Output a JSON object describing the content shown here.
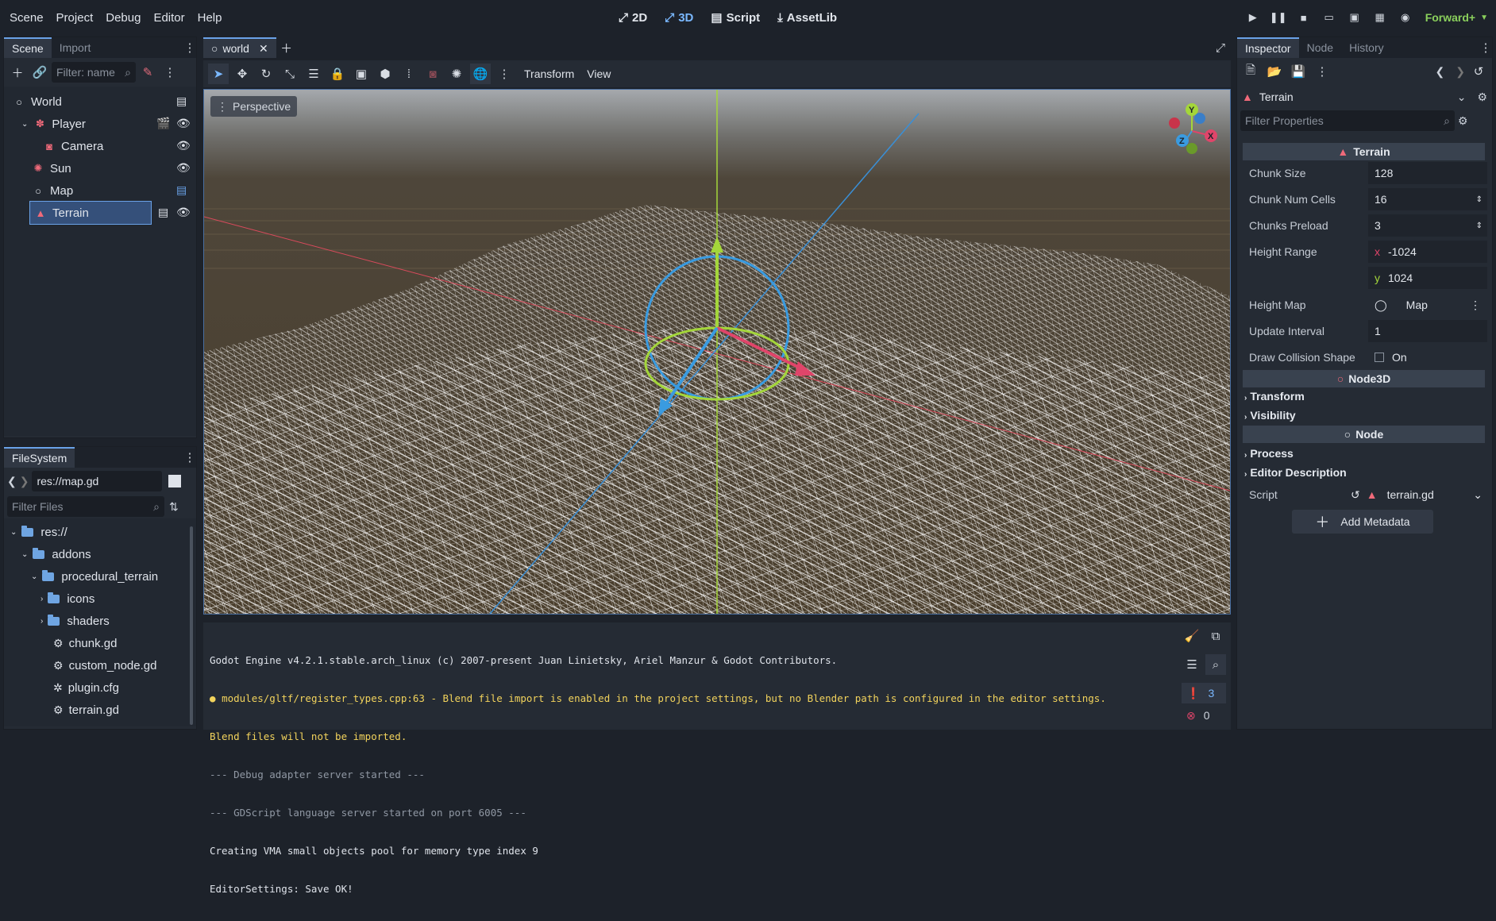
{
  "menu": [
    "Scene",
    "Project",
    "Debug",
    "Editor",
    "Help"
  ],
  "workspaces": [
    {
      "label": "2D",
      "icon": "2d-icon"
    },
    {
      "label": "3D",
      "icon": "3d-icon"
    },
    {
      "label": "Script",
      "icon": "script-icon"
    },
    {
      "label": "AssetLib",
      "icon": "assetlib-icon"
    }
  ],
  "renderer": "Forward+",
  "scene_dock": {
    "tabs": [
      "Scene",
      "Import"
    ],
    "filter_placeholder": "Filter: name",
    "nodes": [
      {
        "label": "World"
      },
      {
        "label": "Player"
      },
      {
        "label": "Camera"
      },
      {
        "label": "Sun"
      },
      {
        "label": "Map"
      },
      {
        "label": "Terrain"
      }
    ]
  },
  "filesystem": {
    "tab": "FileSystem",
    "path": "res://map.gd",
    "filter_placeholder": "Filter Files",
    "items": [
      {
        "label": "res://"
      },
      {
        "label": "addons"
      },
      {
        "label": "procedural_terrain"
      },
      {
        "label": "icons"
      },
      {
        "label": "shaders"
      },
      {
        "label": "chunk.gd"
      },
      {
        "label": "custom_node.gd"
      },
      {
        "label": "plugin.cfg"
      },
      {
        "label": "terrain.gd"
      }
    ]
  },
  "editor_tab": "world",
  "viewport": {
    "toolbar_menus": [
      "Transform",
      "View"
    ],
    "view_label": "Perspective",
    "gizmo": {
      "x": "X",
      "y": "Y",
      "z": "Z"
    }
  },
  "console": {
    "lines": [
      {
        "text": "Godot Engine v4.2.1.stable.arch_linux (c) 2007-present Juan Linietsky, Ariel Manzur & Godot Contributors.",
        "color": "#dfe3ea"
      },
      {
        "text": "modules/gltf/register_types.cpp:63 - Blend file import is enabled in the project settings, but no Blender path is configured in the editor settings.",
        "color": "#f2d35c"
      },
      {
        "text": "Blend files will not be imported.",
        "color": "#f2d35c"
      },
      {
        "text": "--- Debug adapter server started ---",
        "color": "#9098a4"
      },
      {
        "text": "--- GDScript language server started on port 6005 ---",
        "color": "#9098a4"
      },
      {
        "text": "Creating VMA small objects pool for memory type index 9",
        "color": "#dfe3ea"
      },
      {
        "text": "EditorSettings: Save OK!",
        "color": "#dfe3ea"
      }
    ],
    "warnings": "3",
    "errors": "0"
  },
  "inspector": {
    "tabs": [
      "Inspector",
      "Node",
      "History"
    ],
    "object": "Terrain",
    "filter_placeholder": "Filter Properties",
    "section_terrain": "Terrain",
    "props": {
      "chunk_size": {
        "label": "Chunk Size",
        "value": "128"
      },
      "chunk_num_cells": {
        "label": "Chunk Num Cells",
        "value": "16"
      },
      "chunks_preload": {
        "label": "Chunks Preload",
        "value": "3"
      },
      "height_range": {
        "label": "Height Range",
        "x_label": "x",
        "x": "-1024",
        "y_label": "y",
        "y": "1024"
      },
      "height_map": {
        "label": "Height Map",
        "value": "Map"
      },
      "update_interval": {
        "label": "Update Interval",
        "value": "1"
      },
      "draw_collision": {
        "label": "Draw Collision Shape",
        "value": "On"
      }
    },
    "section_node3d": "Node3D",
    "node3d_cats": [
      "Transform",
      "Visibility"
    ],
    "section_node": "Node",
    "node_cats": [
      "Process",
      "Editor Description"
    ],
    "script": {
      "label": "Script",
      "value": "terrain.gd"
    },
    "add_metadata": "Add Metadata"
  }
}
